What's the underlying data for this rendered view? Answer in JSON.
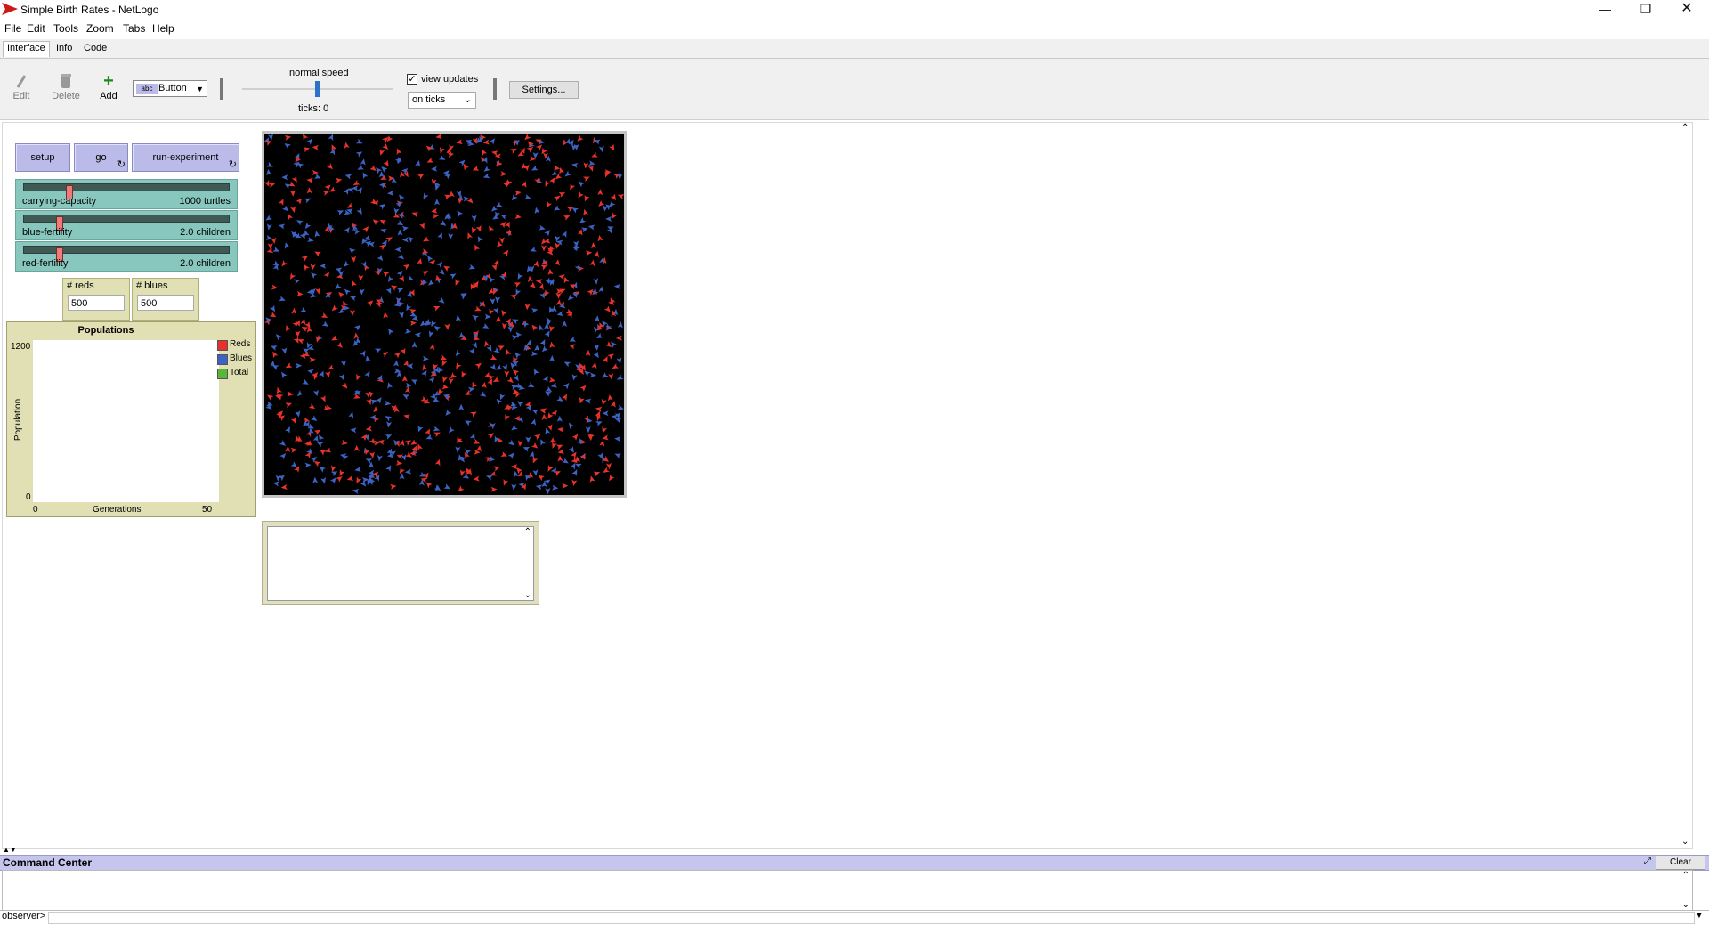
{
  "window": {
    "title": "Simple Birth Rates - NetLogo"
  },
  "menubar": [
    "File",
    "Edit",
    "Tools",
    "Zoom",
    "Tabs",
    "Help"
  ],
  "tabs": [
    {
      "label": "Interface",
      "active": true
    },
    {
      "label": "Info",
      "active": false
    },
    {
      "label": "Code",
      "active": false
    }
  ],
  "toolbar": {
    "edit_label": "Edit",
    "delete_label": "Delete",
    "add_label": "Add",
    "widget_type": "Button",
    "widget_type_icon_text": "abc",
    "speed_label": "normal speed",
    "ticks_text": "ticks: 0",
    "view_updates_label": "view updates",
    "view_updates_checked": true,
    "update_mode": "on ticks",
    "settings_label": "Settings..."
  },
  "buttons": [
    {
      "label": "setup",
      "forever": false
    },
    {
      "label": "go",
      "forever": true
    },
    {
      "label": "run-experiment",
      "forever": true
    }
  ],
  "sliders": [
    {
      "name": "carrying-capacity",
      "value_text": "1000 turtles",
      "fraction": 0.21
    },
    {
      "name": "blue-fertility",
      "value_text": "2.0 children",
      "fraction": 0.16
    },
    {
      "name": "red-fertility",
      "value_text": "2.0 children",
      "fraction": 0.16
    }
  ],
  "monitors": [
    {
      "label": "# reds",
      "value": "500"
    },
    {
      "label": "# blues",
      "value": "500"
    }
  ],
  "plot": {
    "title": "Populations",
    "ylabel": "Population",
    "xlabel": "Generations",
    "ymax": "1200",
    "ymin": "0",
    "xmin": "0",
    "xmax": "50",
    "legend": [
      {
        "name": "Reds",
        "color": "#e8312b"
      },
      {
        "name": "Blues",
        "color": "#3b62c4"
      },
      {
        "name": "Total",
        "color": "#5bb53a"
      }
    ]
  },
  "world": {
    "background": "#000000",
    "turtle_colors": {
      "reds": "#e8312b",
      "blues": "#3b62c4"
    }
  },
  "command_center": {
    "title": "Command Center",
    "clear_label": "Clear",
    "prompt": "observer>"
  },
  "colors": {
    "button_bg": "#babbe8",
    "slider_bg": "#87c7bd",
    "monitor_bg": "#e0e0b4",
    "cc_header_bg": "#c5c5ee"
  }
}
